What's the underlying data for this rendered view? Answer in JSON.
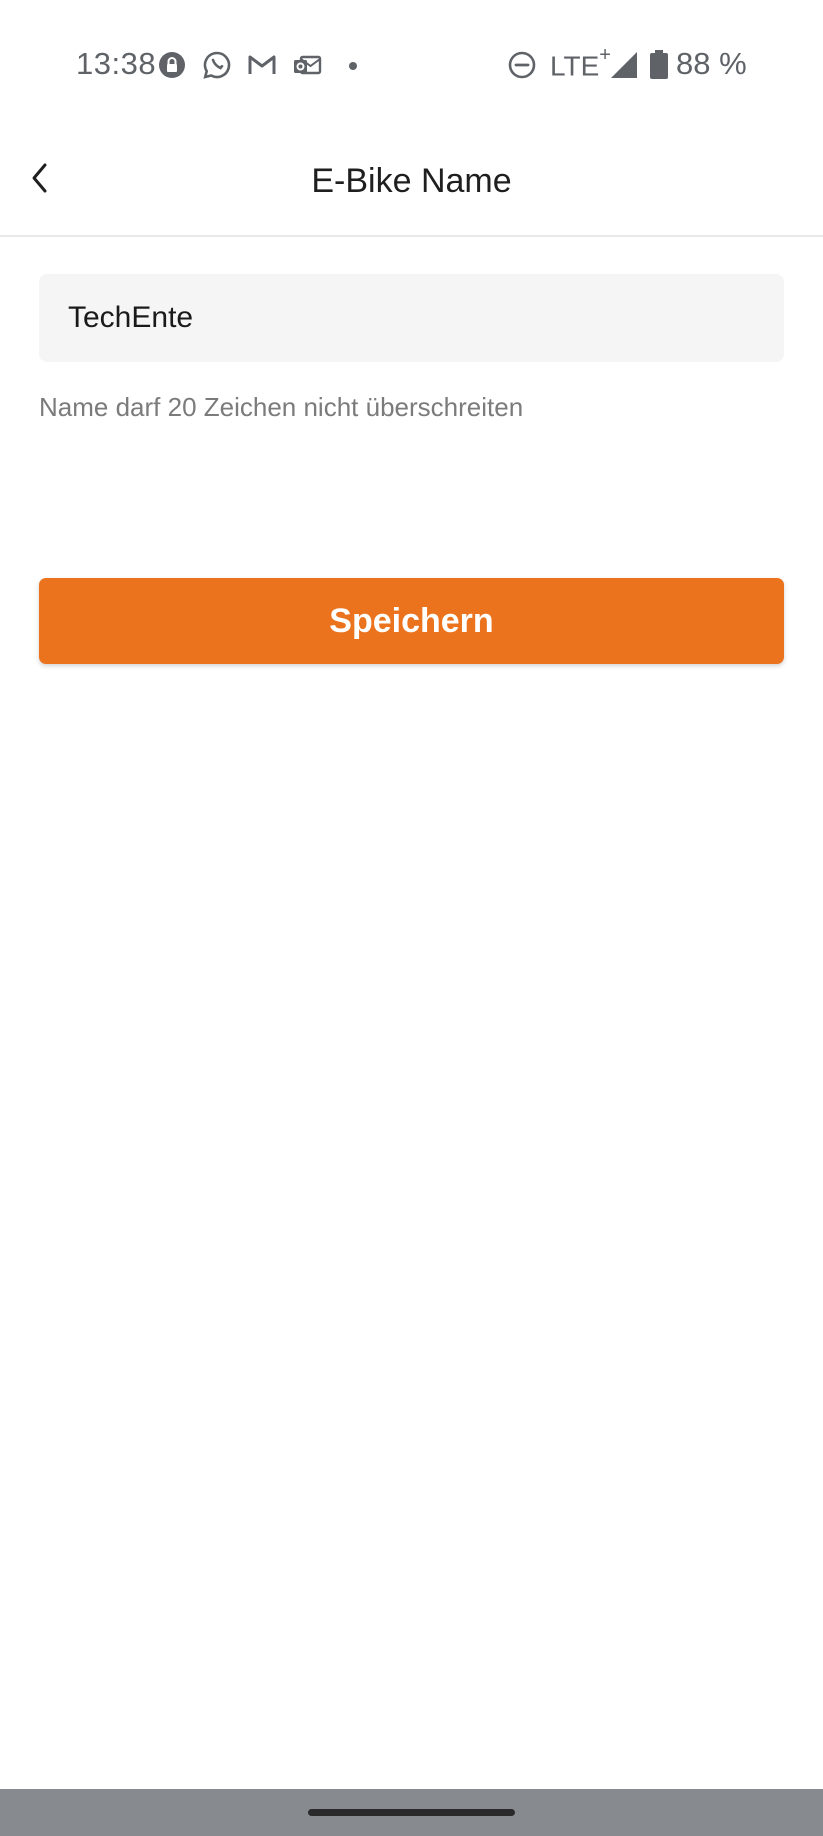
{
  "status_bar": {
    "time": "13:38",
    "network": "LTE",
    "network_plus": "+",
    "battery": "88 %",
    "icons": [
      "lock-icon",
      "whatsapp-icon",
      "gmail-icon",
      "outlook-icon",
      "dot-icon",
      "dnd-icon",
      "signal-icon",
      "battery-icon"
    ]
  },
  "app_bar": {
    "title": "E-Bike Name",
    "back_icon": "chevron-left-icon"
  },
  "form": {
    "name_value": "TechEnte",
    "hint": "Name darf 20 Zeichen nicht überschreiten",
    "save_label": "Speichern"
  },
  "colors": {
    "accent": "#ec731d",
    "input_background": "#f5f5f5",
    "nav_bar": "#878a8e"
  }
}
